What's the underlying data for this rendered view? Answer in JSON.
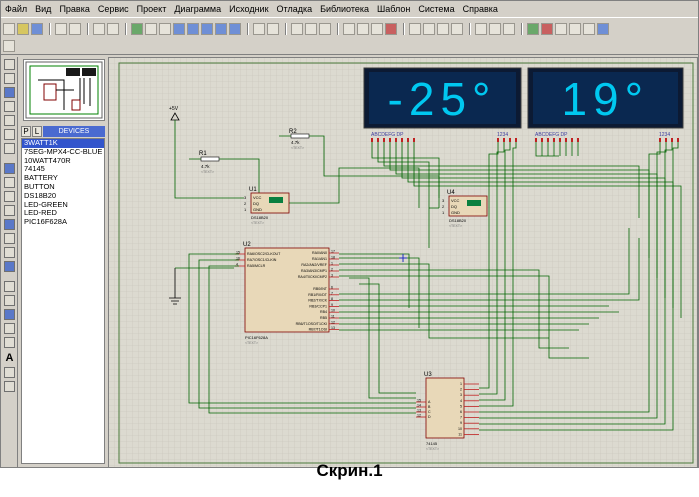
{
  "menu": [
    "Файл",
    "Вид",
    "Правка",
    "Сервис",
    "Проект",
    "Диаграмма",
    "Исходник",
    "Отладка",
    "Библиотека",
    "Шаблон",
    "Система",
    "Справка"
  ],
  "panel": {
    "tab_p": "P",
    "tab_l": "L",
    "header": "DEVICES"
  },
  "devices": [
    "3WATT1K",
    "7SEG-MPX4-CC-BLUE",
    "10WATT470R",
    "74145",
    "BATTERY",
    "BUTTON",
    "DS18B20",
    "LED-GREEN",
    "LED-RED",
    "PIC16F628A"
  ],
  "schematic": {
    "display1": "-25°",
    "display2": "19°",
    "seg_label": "ABCDEFG DP",
    "digit_label": "1234",
    "power_label": "+5V",
    "r1": {
      "ref": "R1",
      "val": "4.7k"
    },
    "r2": {
      "ref": "R2",
      "val": "4.7k"
    },
    "u1": {
      "ref": "U1",
      "part": "DS18B20",
      "pins": [
        "VCC",
        "DQ",
        "GND"
      ],
      "pin_nums": [
        "3",
        "2",
        "1"
      ]
    },
    "u4": {
      "ref": "U4",
      "part": "DS18B20",
      "pins": [
        "VCC",
        "DQ",
        "GND"
      ],
      "pin_nums": [
        "3",
        "2",
        "1"
      ]
    },
    "u2": {
      "ref": "U2",
      "part": "PIC16F628A",
      "left_pins": [
        "RA6/OSC2/CLKOUT",
        "RA7/OSC1/CLKIN",
        "RA5/MCLR"
      ],
      "left_nums": [
        "15",
        "16",
        "4"
      ],
      "right_pins": [
        "RA0/AN0",
        "RA1/AN1",
        "RA2/AN2/VREF",
        "RA3/AN3/CMP1",
        "RA4/T0CKI/CMP2",
        "RB0/INT",
        "RB1/RX/DT",
        "RB2/TX/CK",
        "RB3/CCP1",
        "RB4",
        "RB5",
        "RB6/T1OSO/T1CKI",
        "RB7/T1OSI"
      ],
      "right_nums": [
        "17",
        "18",
        "1",
        "2",
        "3",
        "6",
        "7",
        "8",
        "9",
        "10",
        "11",
        "12",
        "13"
      ]
    },
    "u3": {
      "ref": "U3",
      "part": "74145",
      "left_pins": [
        "A",
        "B",
        "C",
        "D"
      ],
      "left_nums": [
        "15",
        "14",
        "13",
        "12"
      ],
      "right_nums": [
        "1",
        "2",
        "3",
        "4",
        "5",
        "6",
        "7",
        "9",
        "10",
        "11"
      ]
    },
    "text_tag": "<TEXT>"
  },
  "caption": "Скрин.1"
}
